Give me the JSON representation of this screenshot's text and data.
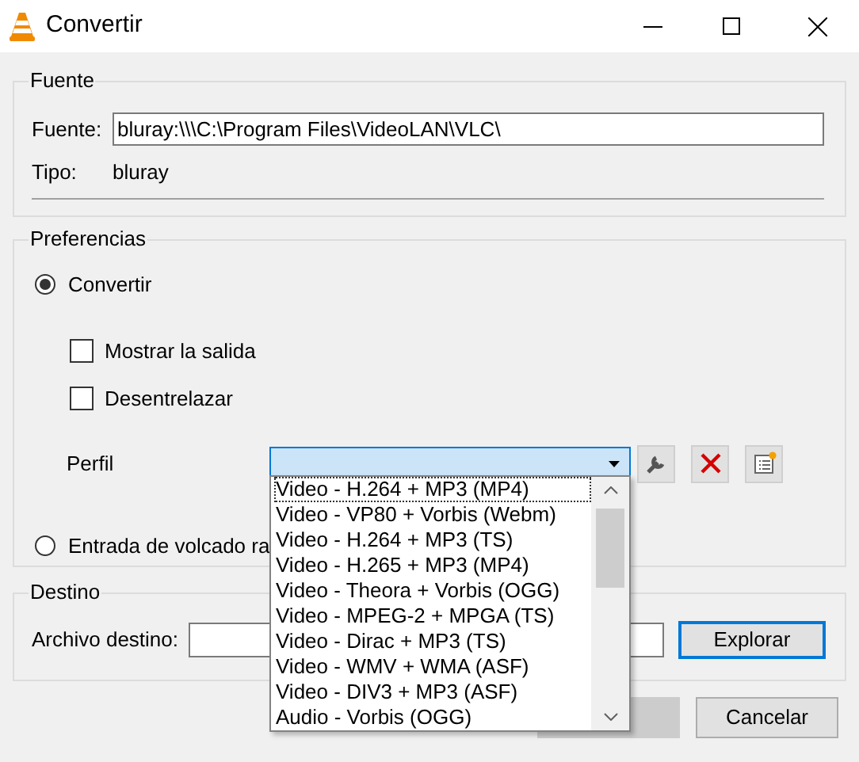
{
  "window": {
    "title": "Convertir"
  },
  "source": {
    "legend": "Fuente",
    "field_label": "Fuente:",
    "field_value": "bluray:\\\\\\C:\\Program Files\\VideoLAN\\VLC\\",
    "type_label": "Tipo:",
    "type_value": "bluray"
  },
  "preferences": {
    "legend": "Preferencias",
    "convert": {
      "label": "Convertir",
      "selected": true
    },
    "options": [
      {
        "label": "Mostrar la salida",
        "checked": false
      },
      {
        "label": "Desentrelazar",
        "checked": false
      }
    ],
    "profile_label": "Perfil",
    "raw_dump": {
      "label": "Entrada de volcado ra",
      "selected": false
    }
  },
  "profile_dropdown": {
    "expanded": true,
    "items": [
      {
        "label": "Video - H.264 + MP3 (MP4)",
        "selected": true
      },
      {
        "label": "Video - VP80 + Vorbis (Webm)",
        "selected": false
      },
      {
        "label": "Video - H.264 + MP3 (TS)",
        "selected": false
      },
      {
        "label": "Video - H.265 + MP3 (MP4)",
        "selected": false
      },
      {
        "label": "Video - Theora + Vorbis (OGG)",
        "selected": false
      },
      {
        "label": "Video - MPEG-2 + MPGA (TS)",
        "selected": false
      },
      {
        "label": "Video - Dirac + MP3 (TS)",
        "selected": false
      },
      {
        "label": "Video - WMV + WMA (ASF)",
        "selected": false
      },
      {
        "label": "Video - DIV3 + MP3 (ASF)",
        "selected": false
      },
      {
        "label": "Audio - Vorbis (OGG)",
        "selected": false
      }
    ]
  },
  "destination": {
    "legend": "Destino",
    "field_label": "Archivo destino:",
    "browse_button": "Explorar"
  },
  "buttons": [
    {
      "disabled": true
    },
    {
      "label": "Cancelar",
      "disabled": false
    }
  ]
}
